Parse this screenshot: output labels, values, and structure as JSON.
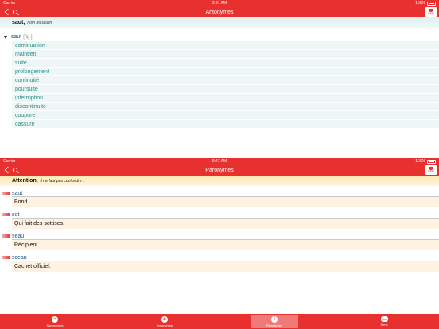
{
  "top": {
    "status": {
      "carrier": "Carrier",
      "time": "9:91 AM",
      "battery": "100%"
    },
    "title": "Antonymes",
    "logo_text": "Robert",
    "word": "saut,",
    "pos": "nom masculin",
    "entry": {
      "word": "saut",
      "tag": "[fig.]"
    },
    "antonyms": [
      "continuation",
      "maintien",
      "suite",
      "prolongement",
      "continuité",
      "poursuite",
      "interruption",
      "discontinuité",
      "coupure",
      "cassure"
    ]
  },
  "bottom": {
    "status": {
      "carrier": "Carrier",
      "time": "9:47 AM",
      "battery": "100%"
    },
    "title": "Paronymes",
    "logo_text": "Robert",
    "attention": "Attention,",
    "note": "il ne faut pas confondre :",
    "paronyms": [
      {
        "word": "saut",
        "def": "Bond."
      },
      {
        "word": "sot",
        "def": "Qui fait des sottises."
      },
      {
        "word": "seau",
        "def": "Récipient."
      },
      {
        "word": "sceau",
        "def": "Cachet officiel."
      }
    ]
  },
  "tabs": [
    {
      "label": "Synonymes",
      "icon": "synonymes-icon",
      "active": false
    },
    {
      "label": "Antonymes",
      "icon": "antonymes-icon",
      "active": false
    },
    {
      "label": "Paronymes",
      "icon": "exclamation-icon",
      "active": true
    },
    {
      "label": "Sens",
      "icon": "speech-bubble-icon",
      "active": false
    }
  ],
  "colors": {
    "brand": "#e8302f",
    "link": "#2b8c86",
    "headword": "#1a4f83"
  }
}
